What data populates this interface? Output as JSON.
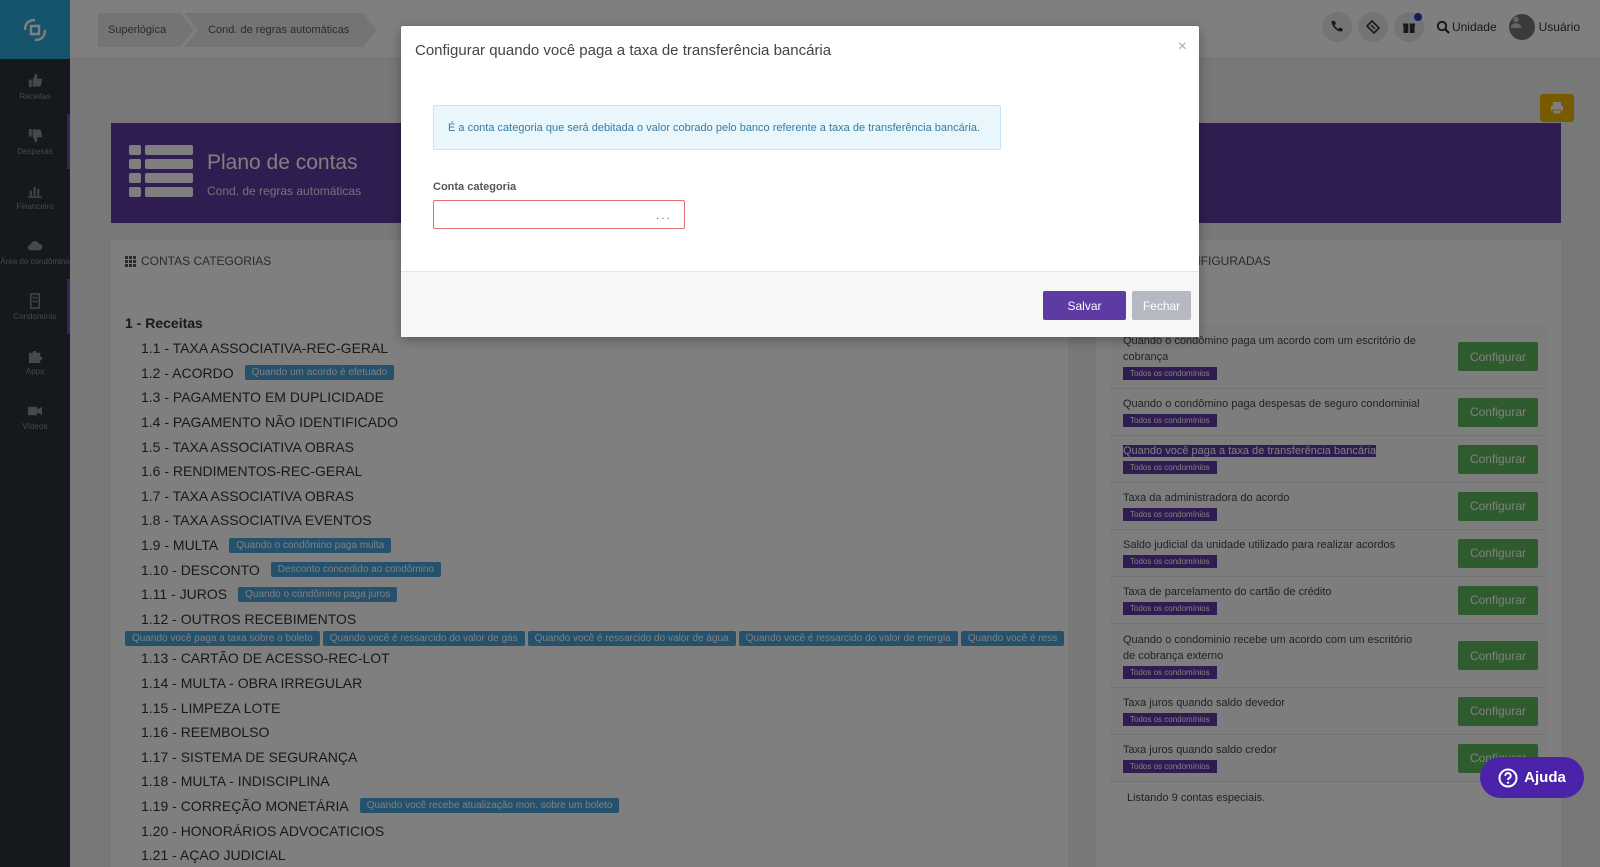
{
  "colors": {
    "sidebar": "#2b3138",
    "brand": "#2aa8d8",
    "purple": "#5e3aa3",
    "tag": "#4aa3d8",
    "configure": "#5cb85c",
    "help": "#4a23a8"
  },
  "sidebar": {
    "items": [
      {
        "label": "Receitas",
        "icon": "thumbs-up-icon"
      },
      {
        "label": "Despesas",
        "icon": "thumbs-down-icon"
      },
      {
        "label": "Financeiro",
        "icon": "bar-chart-icon"
      },
      {
        "label": "Área do condômino",
        "icon": "cloud-icon"
      },
      {
        "label": "Condomínio",
        "icon": "building-icon"
      },
      {
        "label": "Apps",
        "icon": "puzzle-icon"
      },
      {
        "label": "Vídeos",
        "icon": "video-icon"
      }
    ]
  },
  "breadcrumb": [
    "Superlógica",
    "Cond. de regras automáticas"
  ],
  "topbar": {
    "unit_label": "Unidade",
    "user_label": "Usuário"
  },
  "banner": {
    "title": "Plano de contas",
    "subtitle": "Cond. de regras automáticas"
  },
  "left_panel": {
    "heading": "CONTAS CATEGORIAS",
    "group": "1 - Receitas",
    "accounts": [
      {
        "label": "1.1 - TAXA ASSOCIATIVA-REC-GERAL"
      },
      {
        "label": "1.2 - ACORDO",
        "tag": "Quando um acordo é efetuado"
      },
      {
        "label": "1.3 - PAGAMENTO EM DUPLICIDADE"
      },
      {
        "label": "1.4 - PAGAMENTO NÃO IDENTIFICADO"
      },
      {
        "label": "1.5 - TAXA ASSOCIATIVA OBRAS"
      },
      {
        "label": "1.6 - RENDIMENTOS-REC-GERAL"
      },
      {
        "label": "1.7 - TAXA ASSOCIATIVA OBRAS"
      },
      {
        "label": "1.8 - TAXA ASSOCIATIVA EVENTOS"
      },
      {
        "label": "1.9 - MULTA",
        "tag": "Quando o condômino paga multa"
      },
      {
        "label": "1.10 - DESCONTO",
        "tag": "Desconto concedido ao condômino"
      },
      {
        "label": "1.11 - JUROS",
        "tag": "Quando o condômino paga juros"
      },
      {
        "label": "1.12 - OUTROS RECEBIMENTOS"
      },
      {
        "label": "1.13 - CARTÃO DE ACESSO-REC-LOT"
      },
      {
        "label": "1.14 - MULTA - OBRA IRREGULAR"
      },
      {
        "label": "1.15 - LIMPEZA LOTE"
      },
      {
        "label": "1.16 - REEMBOLSO"
      },
      {
        "label": "1.17 - SISTEMA DE SEGURANÇA"
      },
      {
        "label": "1.18 - MULTA - INDISCIPLINA"
      },
      {
        "label": "1.19 - CORREÇÃO MONETÁRIA",
        "tag": "Quando você recebe atualização mon. sobre um boleto"
      },
      {
        "label": "1.20 - HONORÁRIOS ADVOCATICIOS"
      },
      {
        "label": "1.21 - AÇAO JUDICIAL"
      }
    ],
    "tags_112": [
      "Quando você paga a taxa sobre o boleto",
      "Quando você é ressarcido do valor de gás",
      "Quando você é ressarcido do valor de água",
      "Quando você é ressarcido do valor de energia",
      "Quando você é ress"
    ]
  },
  "right_panel": {
    "heading": "CIAIS NÃO CONFIGURADAS",
    "configure_label": "Configurar",
    "badge": "Todos os condomínios",
    "items": [
      {
        "text": "Quando o condômino paga um acordo com um escritório de cobrança"
      },
      {
        "text": "Quando o condômino paga despesas de seguro condominial"
      },
      {
        "text": "Quando você paga a taxa de transferência bancária",
        "highlight": true
      },
      {
        "text": "Taxa da administradora do acordo"
      },
      {
        "text": "Saldo judicial da unidade utilizado para realizar acordos"
      },
      {
        "text": "Taxa de parcelamento do cartão de crédito"
      },
      {
        "text": "Quando o condominio recebe um acordo com um escritório de cobrança externo"
      },
      {
        "text": "Taxa juros quando saldo devedor"
      },
      {
        "text": "Taxa juros quando saldo credor"
      }
    ],
    "listing": "Listando 9 contas especiais."
  },
  "help": {
    "label": "Ajuda"
  },
  "modal": {
    "title": "Configurar quando você paga a taxa de transferência bancária",
    "close": "×",
    "info": "É a conta categoria que será debitada o valor cobrado pelo banco referente a taxa de transferência bancária.",
    "field_label": "Conta categoria",
    "field_value": "",
    "field_ellipsis": "...",
    "save": "Salvar",
    "cancel": "Fechar"
  }
}
